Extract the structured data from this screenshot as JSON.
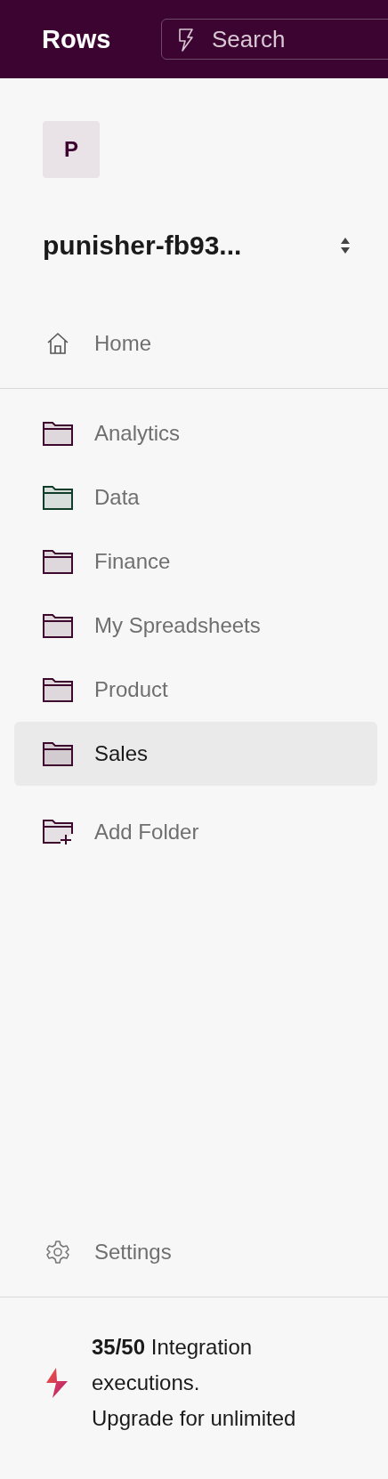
{
  "header": {
    "logo": "Rows",
    "search": {
      "placeholder": "Search"
    }
  },
  "workspace": {
    "avatar": "P",
    "name": "punisher-fb93..."
  },
  "home": {
    "label": "Home"
  },
  "folders": [
    {
      "label": "Analytics",
      "color": "#3d0a2e",
      "selected": false
    },
    {
      "label": "Data",
      "color": "#0f3d2a",
      "selected": false
    },
    {
      "label": "Finance",
      "color": "#3d0a2e",
      "selected": false
    },
    {
      "label": "My Spreadsheets",
      "color": "#3d0a2e",
      "selected": false
    },
    {
      "label": "Product",
      "color": "#3d0a2e",
      "selected": false
    },
    {
      "label": "Sales",
      "color": "#3d0a2e",
      "selected": true
    }
  ],
  "add_folder": {
    "label": "Add Folder"
  },
  "settings": {
    "label": "Settings"
  },
  "usage": {
    "text": "**35/50** Integration executions.",
    "link": "Upgrade for unlimited"
  }
}
